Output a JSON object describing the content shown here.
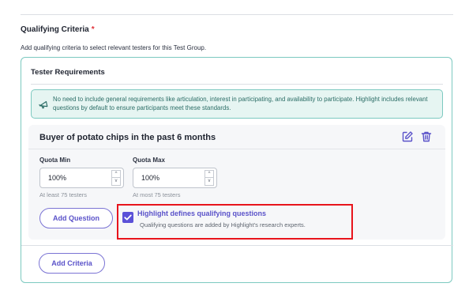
{
  "section": {
    "title": "Qualifying Criteria",
    "required_mark": "*",
    "description": "Add qualifying criteria to select relevant testers for this Test Group."
  },
  "tester_requirements": {
    "title": "Tester Requirements",
    "info_text": "No need to include general requirements like articulation, interest in participating, and availability to participate. Highlight includes relevant questions by default to ensure participants meet these standards.",
    "info_icon": "megaphone-icon"
  },
  "criterion": {
    "title": "Buyer of potato chips in the past 6 months",
    "edit_icon": "edit-icon",
    "delete_icon": "trash-icon",
    "quota_min": {
      "label": "Quota Min",
      "value": "100%",
      "hint": "At least 75 testers"
    },
    "quota_max": {
      "label": "Quota Max",
      "value": "100%",
      "hint": "At most 75 testers"
    },
    "add_question_label": "Add Question",
    "highlight_option": {
      "checked": true,
      "title": "Highlight defines qualifying questions",
      "description": "Qualifying questions are added by Highlight's research experts."
    }
  },
  "add_criteria_label": "Add Criteria",
  "colors": {
    "accent": "#5b51d8",
    "teal_border": "#7cc9c0",
    "info_bg": "#e6f5f2",
    "required": "#e0323a",
    "highlight_outline": "#e8141c"
  }
}
